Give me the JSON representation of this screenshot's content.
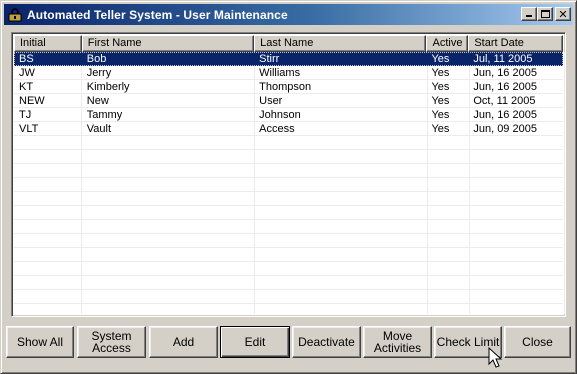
{
  "window": {
    "title": "Automated Teller System - User Maintenance"
  },
  "title_buttons": {
    "minimize": "minimize-icon",
    "maximize": "maximize-icon",
    "close": "close-icon"
  },
  "table": {
    "columns": [
      "Initial",
      "First Name",
      "Last Name",
      "Active",
      "Start Date"
    ],
    "rows": [
      {
        "initial": "BS",
        "first": "Bob",
        "last": "Stirr",
        "active": "Yes",
        "start": "Jul, 11 2005"
      },
      {
        "initial": "JW",
        "first": "Jerry",
        "last": "Williams",
        "active": "Yes",
        "start": "Jun, 16 2005"
      },
      {
        "initial": "KT",
        "first": "Kimberly",
        "last": "Thompson",
        "active": "Yes",
        "start": "Jun, 16 2005"
      },
      {
        "initial": "NEW",
        "first": "New",
        "last": "User",
        "active": "Yes",
        "start": "Oct, 11 2005"
      },
      {
        "initial": "TJ",
        "first": "Tammy",
        "last": "Johnson",
        "active": "Yes",
        "start": "Jun, 16 2005"
      },
      {
        "initial": "VLT",
        "first": "Vault",
        "last": "Access",
        "active": "Yes",
        "start": "Jun, 09 2005"
      }
    ]
  },
  "buttons": {
    "show_all": "Show All",
    "system_access_line1": "System",
    "system_access_line2": "Access",
    "add": "Add",
    "edit": "Edit",
    "deactivate": "Deactivate",
    "move_activities_line1": "Move",
    "move_activities_line2": "Activities",
    "check_limit": "Check Limit",
    "close": "Close"
  },
  "colors": {
    "selection": "#0a246a",
    "titlebar_start": "#0a246a",
    "titlebar_end": "#a6caf0",
    "face": "#d4d0c8"
  }
}
